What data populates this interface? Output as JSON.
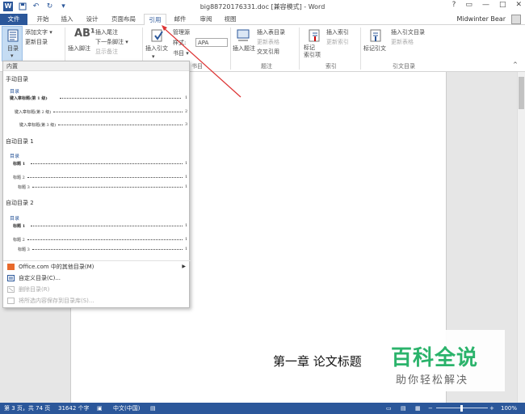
{
  "window": {
    "title": "big88720176331.doc [兼容模式] - Word",
    "user": "Midwinter Bear",
    "buttons": [
      "?",
      "▭",
      "—",
      "□",
      "✕"
    ]
  },
  "tabs": [
    {
      "label": "文件"
    },
    {
      "label": "开始"
    },
    {
      "label": "插入"
    },
    {
      "label": "设计"
    },
    {
      "label": "页面布局"
    },
    {
      "label": "引用"
    },
    {
      "label": "邮件"
    },
    {
      "label": "审阅"
    },
    {
      "label": "视图"
    }
  ],
  "ribbon": {
    "toc_label": "目录",
    "add_text": "添加文字 ▾",
    "update_toc": "更新目录",
    "insert_footnote": "插入脚注",
    "insert_endnote": "插入尾注",
    "next_footnote": "下一条脚注 ▾",
    "show_notes": "显示备注",
    "insert_citation": "插入引文",
    "manage_sources": "管理源",
    "style_label": "样式:",
    "style_value": "APA",
    "bibliography": "书目 ▾",
    "group_citations": "书目",
    "insert_caption": "插入题注",
    "insert_table_of_figures": "插入表目录",
    "update_table": "更新表格",
    "cross_reference": "交叉引用",
    "group_captions": "题注",
    "mark_entry": "标记\n索引项",
    "insert_index": "插入索引",
    "update_index": "更新索引",
    "group_index": "索引",
    "mark_citation": "标记引文",
    "insert_table_of_authorities": "插入引文目录",
    "update_authorities": "更新表格",
    "group_authorities": "引文目录"
  },
  "dropdown": {
    "header": "内置",
    "sections": [
      {
        "title": "手动目录",
        "preview_heading": "目录",
        "lines": [
          "键入章标题(第 1 级)",
          "键入章标题(第 2 级)",
          "键入章标题(第 3 级)"
        ],
        "page_nums": [
          "1",
          "2",
          "3"
        ]
      },
      {
        "title": "自动目录 1",
        "preview_heading": "目录",
        "lines": [
          "标题 1",
          "标题 2",
          "标题 3"
        ],
        "page_nums": [
          "1",
          "1",
          "1"
        ]
      },
      {
        "title": "自动目录 2",
        "preview_heading": "目录",
        "lines": [
          "标题 1",
          "标题 2",
          "标题 3"
        ],
        "page_nums": [
          "1",
          "1",
          "1"
        ]
      }
    ],
    "menu": [
      {
        "label": "Office.com 中的其他目录(M)",
        "dim": false,
        "has_arrow": true
      },
      {
        "label": "自定义目录(C)...",
        "dim": false,
        "has_arrow": false
      },
      {
        "label": "删除目录(R)",
        "dim": true,
        "has_arrow": false
      },
      {
        "label": "将所选内容保存到目录库(S)...",
        "dim": true,
        "has_arrow": false
      }
    ]
  },
  "document": {
    "chapter_title": "第一章  论文标题"
  },
  "status": {
    "page": "第 3 页，共 74 页",
    "words": "31642 个字",
    "language": "中文(中国)",
    "zoom": "100%"
  },
  "watermark": {
    "main": "百科全说",
    "sub": "助你轻松解决"
  },
  "colors": {
    "accent": "#2b579a",
    "watermark_green": "#2bb36b"
  }
}
